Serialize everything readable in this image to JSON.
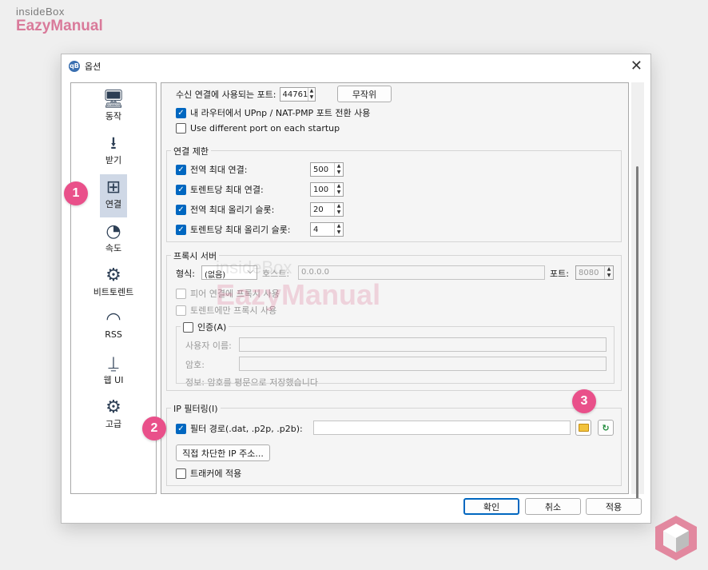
{
  "branding": {
    "line1": "insideBox",
    "line2": "EazyManual"
  },
  "window": {
    "title": "옵션",
    "app_icon": "qB",
    "close": "✕"
  },
  "sidebar": {
    "items": [
      {
        "label": "동작",
        "icon": "🖥"
      },
      {
        "label": "받기",
        "icon": "⭳"
      },
      {
        "label": "연결",
        "icon": "⊞",
        "selected": true
      },
      {
        "label": "속도",
        "icon": "◔"
      },
      {
        "label": "비트토렌트",
        "icon": "⚙"
      },
      {
        "label": "RSS",
        "icon": "◠"
      },
      {
        "label": "웹 UI",
        "icon": "⍊"
      },
      {
        "label": "고급",
        "icon": "⚙"
      }
    ]
  },
  "listening": {
    "port_label": "수신 연결에 사용되는 포트:",
    "port_value": "44761",
    "random_button": "무작위",
    "upnp_label": "내 라우터에서 UPnp / NAT-PMP 포트 전환 사용",
    "diff_port_label": "Use different port on each startup"
  },
  "limits": {
    "title": "연결 제한",
    "rows": [
      {
        "label": "전역 최대 연결:",
        "value": "500"
      },
      {
        "label": "토렌트당 최대 연결:",
        "value": "100"
      },
      {
        "label": "전역 최대 올리기 슬롯:",
        "value": "20"
      },
      {
        "label": "토렌트당 최대 올리기 슬롯:",
        "value": "4"
      }
    ]
  },
  "proxy": {
    "title": "프록시 서버",
    "type_label": "형식:",
    "type_value": "(없음)",
    "host_label": "호스트:",
    "host_value": "0.0.0.0",
    "port_label": "포트:",
    "port_value": "8080",
    "peer_label": "피어 연결에 프록시 사용",
    "torrent_only_label": "토렌트에만 프록시 사용",
    "auth_label": "인증(A)",
    "username_label": "사용자 이름:",
    "password_label": "암호:",
    "info_text": "정보: 암호를 평문으로 저장했습니다"
  },
  "ipfilter": {
    "title": "IP 필터링(I)",
    "path_label": "필터 경로(.dat, .p2p, .p2b):",
    "manual_button": "직접 차단한 IP 주소...",
    "tracker_label": "트래커에 적용"
  },
  "footer": {
    "ok": "확인",
    "cancel": "취소",
    "apply": "적용"
  },
  "annotations": {
    "one": "1",
    "two": "2",
    "three": "3"
  },
  "watermark": {
    "line1": "insideBox",
    "line2": "EazyManual"
  },
  "colors": {
    "accent": "#0067c0",
    "badge": "#e9508a",
    "selected_bg": "#cfd8e6"
  }
}
